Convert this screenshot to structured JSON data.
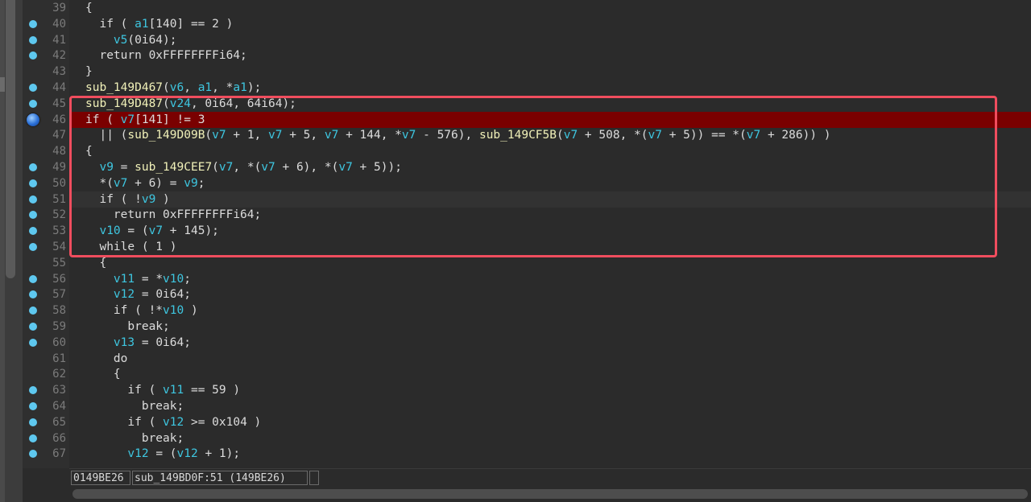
{
  "status": {
    "address": "0149BE26",
    "location": "sub_149BD0F:51 (149BE26)",
    "empty": ""
  },
  "lines": [
    {
      "n": "39",
      "bp": false,
      "t": [
        [
          "p",
          "{"
        ]
      ]
    },
    {
      "n": "40",
      "bp": true,
      "t": [
        [
          "p",
          "  if ( "
        ],
        [
          "v",
          "a1"
        ],
        [
          "p",
          "[140] == 2 )"
        ]
      ]
    },
    {
      "n": "41",
      "bp": true,
      "t": [
        [
          "p",
          "    "
        ],
        [
          "v",
          "v5"
        ],
        [
          "p",
          "(0i64);"
        ]
      ]
    },
    {
      "n": "42",
      "bp": true,
      "t": [
        [
          "p",
          "  return 0xFFFFFFFFi64;"
        ]
      ]
    },
    {
      "n": "43",
      "bp": false,
      "t": [
        [
          "p",
          "}"
        ]
      ]
    },
    {
      "n": "44",
      "bp": true,
      "t": [
        [
          "f",
          "sub_149D467"
        ],
        [
          "p",
          "("
        ],
        [
          "v",
          "v6"
        ],
        [
          "p",
          ", "
        ],
        [
          "v",
          "a1"
        ],
        [
          "p",
          ", *"
        ],
        [
          "v",
          "a1"
        ],
        [
          "p",
          ");"
        ]
      ]
    },
    {
      "n": "45",
      "bp": true,
      "t": [
        [
          "f",
          "sub_149D487"
        ],
        [
          "p",
          "("
        ],
        [
          "v",
          "v24"
        ],
        [
          "p",
          ", 0i64, 64i64);"
        ]
      ]
    },
    {
      "n": "46",
      "bp": "active",
      "hl": true,
      "t": [
        [
          "p",
          "if ( "
        ],
        [
          "v",
          "v7"
        ],
        [
          "p",
          "[141] != 3"
        ]
      ]
    },
    {
      "n": "47",
      "bp": false,
      "t": [
        [
          "p",
          "  || ("
        ],
        [
          "f",
          "sub_149D09B"
        ],
        [
          "p",
          "("
        ],
        [
          "v",
          "v7"
        ],
        [
          "p",
          " + 1, "
        ],
        [
          "v",
          "v7"
        ],
        [
          "p",
          " + 5, "
        ],
        [
          "v",
          "v7"
        ],
        [
          "p",
          " + 144, *"
        ],
        [
          "v",
          "v7"
        ],
        [
          "p",
          " - 576), "
        ],
        [
          "f",
          "sub_149CF5B"
        ],
        [
          "p",
          "("
        ],
        [
          "v",
          "v7"
        ],
        [
          "p",
          " + 508, *("
        ],
        [
          "v",
          "v7"
        ],
        [
          "p",
          " + 5)) == *("
        ],
        [
          "v",
          "v7"
        ],
        [
          "p",
          " + 286)) )"
        ]
      ]
    },
    {
      "n": "48",
      "bp": false,
      "t": [
        [
          "p",
          "{"
        ]
      ]
    },
    {
      "n": "49",
      "bp": true,
      "t": [
        [
          "p",
          "  "
        ],
        [
          "v",
          "v9"
        ],
        [
          "p",
          " = "
        ],
        [
          "f",
          "sub_149CEE7"
        ],
        [
          "p",
          "("
        ],
        [
          "v",
          "v7"
        ],
        [
          "p",
          ", *("
        ],
        [
          "v",
          "v7"
        ],
        [
          "p",
          " + 6), *("
        ],
        [
          "v",
          "v7"
        ],
        [
          "p",
          " + 5));"
        ]
      ]
    },
    {
      "n": "50",
      "bp": true,
      "t": [
        [
          "p",
          "  *("
        ],
        [
          "v",
          "v7"
        ],
        [
          "p",
          " + 6) = "
        ],
        [
          "v",
          "v9"
        ],
        [
          "p",
          ";"
        ]
      ]
    },
    {
      "n": "51",
      "bp": true,
      "cursor": true,
      "t": [
        [
          "p",
          "  if ( !"
        ],
        [
          "v",
          "v9"
        ],
        [
          "p",
          " )"
        ]
      ]
    },
    {
      "n": "52",
      "bp": true,
      "t": [
        [
          "p",
          "    return 0xFFFFFFFFi64;"
        ]
      ]
    },
    {
      "n": "53",
      "bp": true,
      "t": [
        [
          "p",
          "  "
        ],
        [
          "v",
          "v10"
        ],
        [
          "p",
          " = ("
        ],
        [
          "v",
          "v7"
        ],
        [
          "p",
          " + 145);"
        ]
      ]
    },
    {
      "n": "54",
      "bp": true,
      "t": [
        [
          "p",
          "  while ( 1 )"
        ]
      ]
    },
    {
      "n": "55",
      "bp": false,
      "t": [
        [
          "p",
          "  {"
        ]
      ]
    },
    {
      "n": "56",
      "bp": true,
      "t": [
        [
          "p",
          "    "
        ],
        [
          "v",
          "v11"
        ],
        [
          "p",
          " = *"
        ],
        [
          "v",
          "v10"
        ],
        [
          "p",
          ";"
        ]
      ]
    },
    {
      "n": "57",
      "bp": true,
      "t": [
        [
          "p",
          "    "
        ],
        [
          "v",
          "v12"
        ],
        [
          "p",
          " = 0i64;"
        ]
      ]
    },
    {
      "n": "58",
      "bp": true,
      "t": [
        [
          "p",
          "    if ( !*"
        ],
        [
          "v",
          "v10"
        ],
        [
          "p",
          " )"
        ]
      ]
    },
    {
      "n": "59",
      "bp": true,
      "t": [
        [
          "p",
          "      break;"
        ]
      ]
    },
    {
      "n": "60",
      "bp": true,
      "t": [
        [
          "p",
          "    "
        ],
        [
          "v",
          "v13"
        ],
        [
          "p",
          " = 0i64;"
        ]
      ]
    },
    {
      "n": "61",
      "bp": false,
      "t": [
        [
          "p",
          "    do"
        ]
      ]
    },
    {
      "n": "62",
      "bp": false,
      "t": [
        [
          "p",
          "    {"
        ]
      ]
    },
    {
      "n": "63",
      "bp": true,
      "t": [
        [
          "p",
          "      if ( "
        ],
        [
          "v",
          "v11"
        ],
        [
          "p",
          " == 59 )"
        ]
      ]
    },
    {
      "n": "64",
      "bp": true,
      "t": [
        [
          "p",
          "        break;"
        ]
      ]
    },
    {
      "n": "65",
      "bp": true,
      "t": [
        [
          "p",
          "      if ( "
        ],
        [
          "v",
          "v12"
        ],
        [
          "p",
          " >= 0x104 )"
        ]
      ]
    },
    {
      "n": "66",
      "bp": true,
      "t": [
        [
          "p",
          "        break;"
        ]
      ]
    },
    {
      "n": "67",
      "bp": true,
      "t": [
        [
          "p",
          "      "
        ],
        [
          "v",
          "v12"
        ],
        [
          "p",
          " = ("
        ],
        [
          "v",
          "v12"
        ],
        [
          "p",
          " + 1);"
        ]
      ]
    }
  ]
}
